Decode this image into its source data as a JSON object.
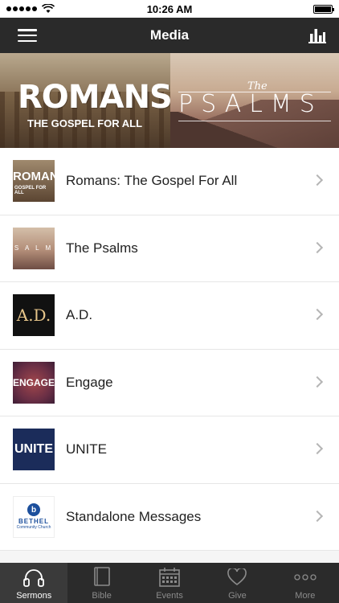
{
  "status_bar": {
    "time": "10:26 AM"
  },
  "nav": {
    "title": "Media"
  },
  "banner": {
    "left": {
      "title": "ROMANS",
      "subtitle": "THE GOSPEL FOR ALL"
    },
    "right": {
      "prefix": "The",
      "title": "PSALMS"
    }
  },
  "list": {
    "items": [
      {
        "label": "Romans: The Gospel For All",
        "thumb_text": "ROMAN",
        "thumb_sub": "GOSPEL FOR ALL"
      },
      {
        "label": "The Psalms",
        "thumb_text": "S A L M"
      },
      {
        "label": "A.D.",
        "thumb_text": "A.D."
      },
      {
        "label": "Engage",
        "thumb_text": "ENGAGE"
      },
      {
        "label": "UNITE",
        "thumb_text": "UNITE"
      },
      {
        "label": "Standalone Messages",
        "thumb_text": "BETHEL",
        "thumb_sub": "Community Church"
      }
    ]
  },
  "tabs": [
    {
      "label": "Sermons",
      "icon": "headphones-icon",
      "active": true
    },
    {
      "label": "Bible",
      "icon": "book-icon",
      "active": false
    },
    {
      "label": "Events",
      "icon": "calendar-icon",
      "active": false
    },
    {
      "label": "Give",
      "icon": "heart-icon",
      "active": false
    },
    {
      "label": "More",
      "icon": "more-icon",
      "active": false
    }
  ],
  "colors": {
    "nav_bg": "#2a2a2a",
    "tab_bg": "#2b2b2b",
    "active_tab": "#ffffff",
    "inactive_tab": "#8b8b8b"
  }
}
